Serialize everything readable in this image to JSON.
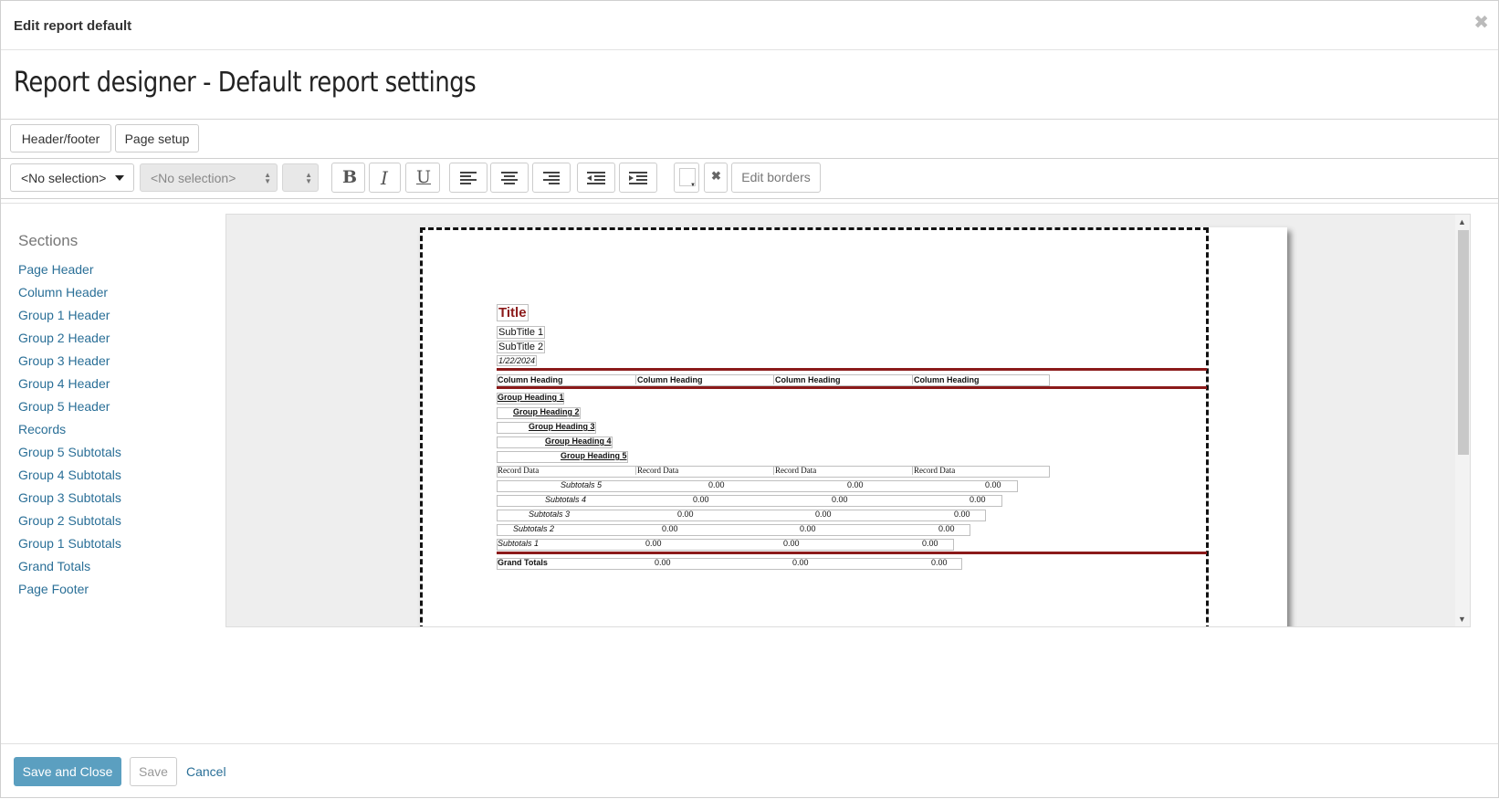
{
  "dialog": {
    "title": "Edit report default",
    "close_icon": "close-icon"
  },
  "page": {
    "title": "Report designer - Default report settings"
  },
  "tabs": [
    {
      "label": "Header/footer"
    },
    {
      "label": "Page setup"
    }
  ],
  "toolbar": {
    "font_select": "<No selection>",
    "font_family_select": "<No selection>",
    "font_size_select": "",
    "bold": "B",
    "italic": "I",
    "underline": "U",
    "edit_borders": "Edit borders"
  },
  "sidebar": {
    "heading": "Sections",
    "items": [
      "Page Header",
      "Column Header",
      "Group 1 Header",
      "Group 2 Header",
      "Group 3 Header",
      "Group 4 Header",
      "Group 5 Header",
      "Records",
      "Group 5 Subtotals",
      "Group 4 Subtotals",
      "Group 3 Subtotals",
      "Group 2 Subtotals",
      "Group 1 Subtotals",
      "Grand Totals",
      "Page Footer"
    ]
  },
  "report": {
    "title": "Title",
    "subtitle1": "SubTitle 1",
    "subtitle2": "SubTitle 2",
    "date": "1/22/2024",
    "column_heading": "Column Heading",
    "groups": [
      "Group Heading 1",
      "Group Heading 2",
      "Group Heading 3",
      "Group Heading 4",
      "Group Heading 5"
    ],
    "record_data": "Record Data",
    "subtotals": [
      "Subtotals 5",
      "Subtotals 4",
      "Subtotals 3",
      "Subtotals 2",
      "Subtotals 1"
    ],
    "grand_totals": "Grand Totals",
    "zero": "0.00",
    "accent_color": "#8b1a1a"
  },
  "footer": {
    "save_close": "Save and Close",
    "save": "Save",
    "cancel": "Cancel"
  }
}
